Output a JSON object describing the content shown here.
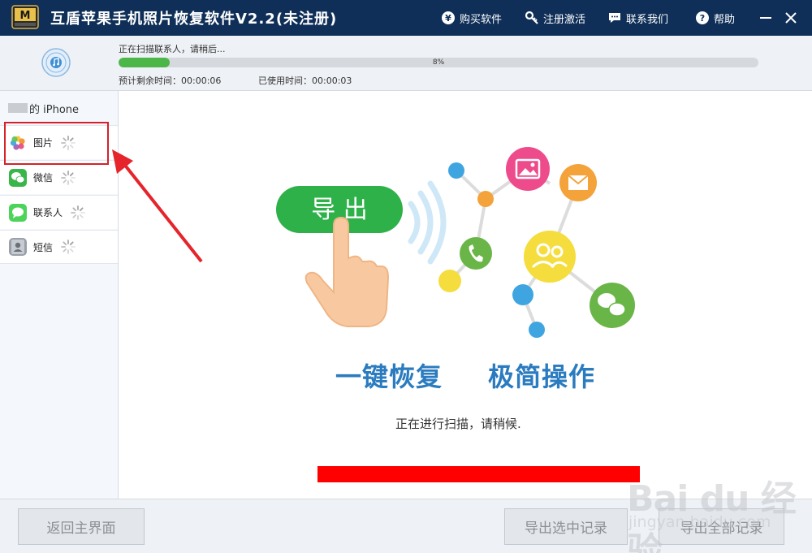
{
  "titlebar": {
    "title": "互盾苹果手机照片恢复软件V2.2(未注册)",
    "buy_label": "购买软件",
    "register_label": "注册激活",
    "contact_label": "联系我们",
    "help_label": "帮助"
  },
  "progress": {
    "status": "正在扫描联系人，请稍后...",
    "percent": 8,
    "percent_label": "8%",
    "remaining": "预计剩余时间：00:00:06",
    "used": "已使用时间：00:00:03",
    "fill_color": "#4cb748"
  },
  "sidebar": {
    "device_suffix": "的 iPhone",
    "items": [
      {
        "label": "图片",
        "icon": "photos-icon"
      },
      {
        "label": "微信",
        "icon": "wechat-icon"
      },
      {
        "label": "联系人",
        "icon": "messages-icon"
      },
      {
        "label": "短信",
        "icon": "contacts-icon"
      }
    ]
  },
  "main": {
    "export_badge": "导 出",
    "slogan_left": "一键恢复",
    "slogan_right": "极简操作",
    "scan_message": "正在进行扫描，请稍候."
  },
  "bottom": {
    "home_label": "返回主界面",
    "export_selected_label": "导出选中记录",
    "export_all_label": "导出全部记录"
  },
  "watermark": {
    "brand": "Bai du 经验",
    "sub": "jingyan.baidu.com"
  },
  "colors": {
    "titlebar": "#0f2f58",
    "accent_blue": "#2a7bbf",
    "green": "#39b54a",
    "highlight_red": "#d6212a"
  }
}
